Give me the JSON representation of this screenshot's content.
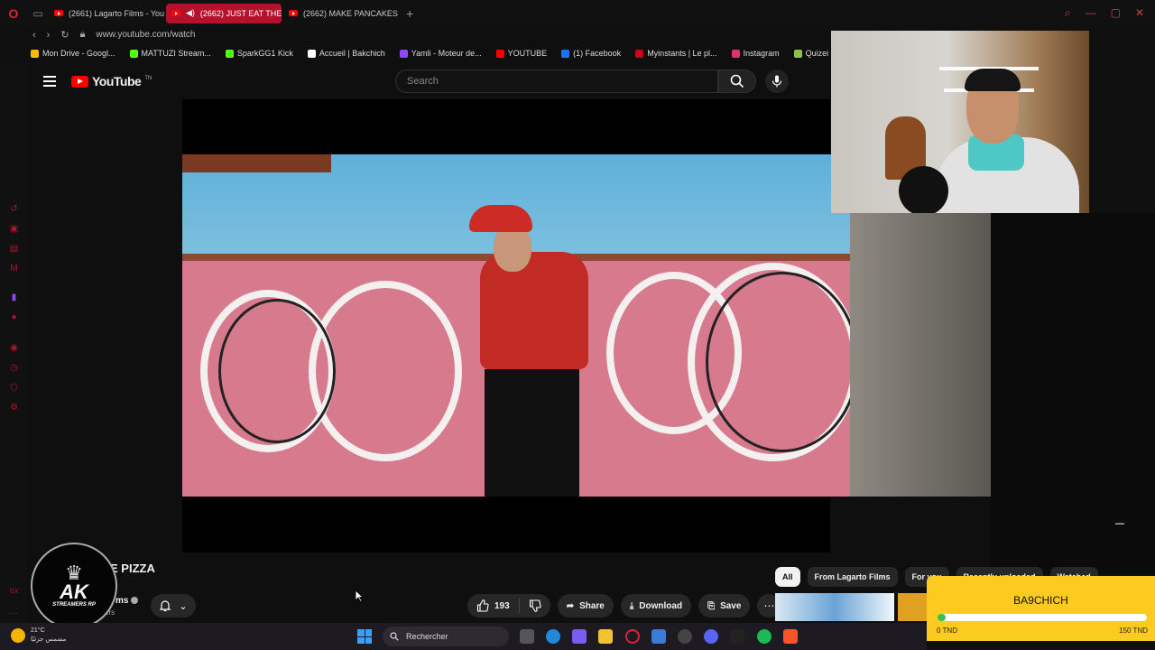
{
  "browser": {
    "tabs": [
      {
        "label": "(2661) Lagarto Films - You",
        "active": false
      },
      {
        "label": "(2662) JUST EAT THE",
        "active": true
      },
      {
        "label": "(2662) MAKE PANCAKES",
        "active": false
      }
    ],
    "url": "www.youtube.com/watch",
    "bookmarks": [
      {
        "label": "Mon Drive - Googl...",
        "color": "#fbbc04"
      },
      {
        "label": "MATTUZI Stream...",
        "color": "#53fc18"
      },
      {
        "label": "SparkGG1 Kick",
        "color": "#53fc18"
      },
      {
        "label": "Accueil | Bakchich",
        "color": "#ffffff"
      },
      {
        "label": "Yamli - Moteur de...",
        "color": "#9146ff"
      },
      {
        "label": "YOUTUBE",
        "color": "#ff0000"
      },
      {
        "label": "(1) Facebook",
        "color": "#1877f2"
      },
      {
        "label": "Myinstants | Le pl...",
        "color": "#d0021b"
      },
      {
        "label": "Instagram",
        "color": "#e1306c"
      },
      {
        "label": "Quizei - Un mond...",
        "color": "#8bc34a"
      }
    ]
  },
  "youtube": {
    "logo_text": "YouTube",
    "logo_suffix": "TN",
    "search_placeholder": "Search",
    "video_title": "E PIZZA",
    "channel_name": "ms",
    "subscribers": "ers",
    "likes": "193",
    "actions": {
      "share": "Share",
      "download": "Download",
      "save": "Save"
    },
    "chips": [
      {
        "label": "All",
        "active": true
      },
      {
        "label": "From Lagarto Films",
        "active": false
      },
      {
        "label": "For you",
        "active": false
      },
      {
        "label": "Recently uploaded",
        "active": false
      },
      {
        "label": "Watched",
        "active": false
      }
    ]
  },
  "overlay": {
    "ak_logo": {
      "title": "AK",
      "subtitle": "STREAMERS RP"
    },
    "donation": {
      "name": "BA9CHICH",
      "min": "0 TND",
      "max": "150 TND",
      "progress": 0.01
    }
  },
  "taskbar": {
    "weather_temp": "21°C",
    "weather_desc": "مشمس جزئيًا",
    "search_label": "Rechercher"
  },
  "colors": {
    "accent": "#b4122c",
    "youtube_red": "#ff0000",
    "goal_yellow": "#fdca20",
    "goal_green": "#3ec04a"
  }
}
